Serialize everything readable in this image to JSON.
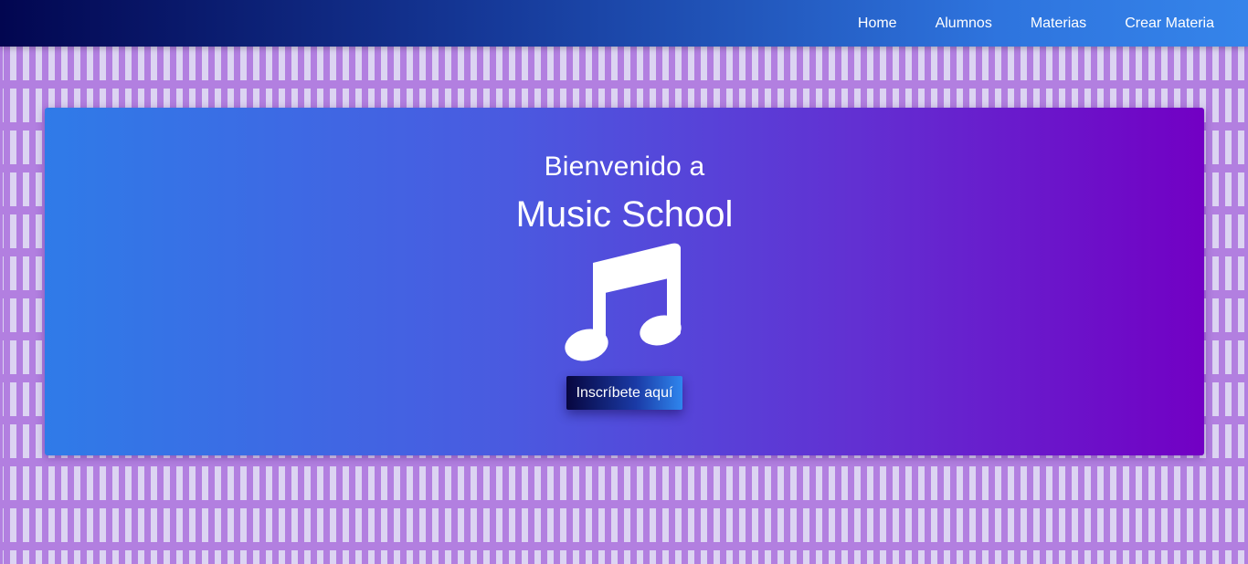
{
  "nav": {
    "items": [
      {
        "label": "Home"
      },
      {
        "label": "Alumnos"
      },
      {
        "label": "Materias"
      },
      {
        "label": "Crear Materia"
      }
    ]
  },
  "hero": {
    "welcome": "Bienvenido a",
    "title": "Music School",
    "icon": "music-note-icon",
    "cta_label": "Inscríbete aquí"
  },
  "colors": {
    "navbar_start": "#020650",
    "navbar_end": "#3584ea",
    "hero_start": "#2f7be8",
    "hero_end": "#7200c4",
    "background": "#dcd4f2",
    "pattern": "#b27fe0"
  }
}
